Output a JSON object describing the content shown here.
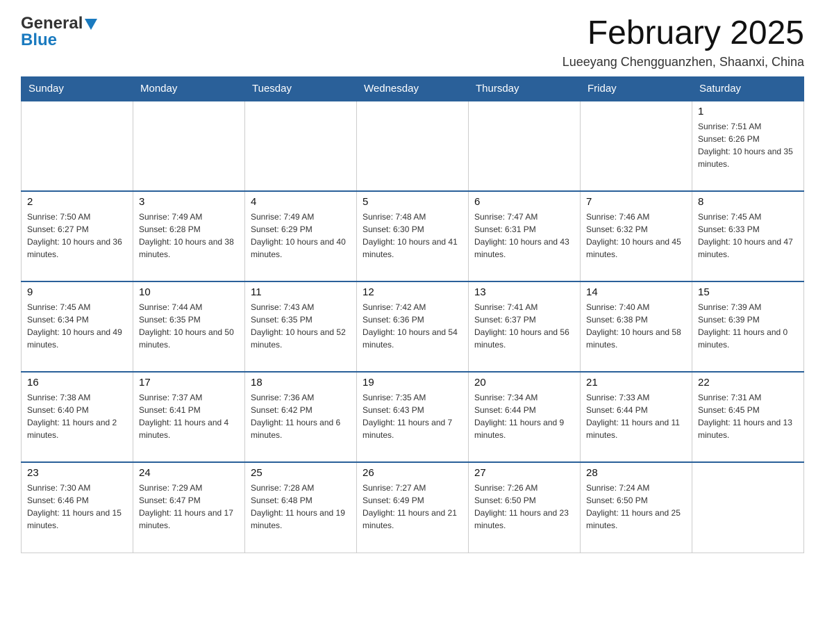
{
  "logo": {
    "general": "General",
    "blue": "Blue"
  },
  "title": "February 2025",
  "subtitle": "Lueeyang Chengguanzhen, Shaanxi, China",
  "days_of_week": [
    "Sunday",
    "Monday",
    "Tuesday",
    "Wednesday",
    "Thursday",
    "Friday",
    "Saturday"
  ],
  "weeks": [
    [
      {
        "day": "",
        "info": ""
      },
      {
        "day": "",
        "info": ""
      },
      {
        "day": "",
        "info": ""
      },
      {
        "day": "",
        "info": ""
      },
      {
        "day": "",
        "info": ""
      },
      {
        "day": "",
        "info": ""
      },
      {
        "day": "1",
        "info": "Sunrise: 7:51 AM\nSunset: 6:26 PM\nDaylight: 10 hours and 35 minutes."
      }
    ],
    [
      {
        "day": "2",
        "info": "Sunrise: 7:50 AM\nSunset: 6:27 PM\nDaylight: 10 hours and 36 minutes."
      },
      {
        "day": "3",
        "info": "Sunrise: 7:49 AM\nSunset: 6:28 PM\nDaylight: 10 hours and 38 minutes."
      },
      {
        "day": "4",
        "info": "Sunrise: 7:49 AM\nSunset: 6:29 PM\nDaylight: 10 hours and 40 minutes."
      },
      {
        "day": "5",
        "info": "Sunrise: 7:48 AM\nSunset: 6:30 PM\nDaylight: 10 hours and 41 minutes."
      },
      {
        "day": "6",
        "info": "Sunrise: 7:47 AM\nSunset: 6:31 PM\nDaylight: 10 hours and 43 minutes."
      },
      {
        "day": "7",
        "info": "Sunrise: 7:46 AM\nSunset: 6:32 PM\nDaylight: 10 hours and 45 minutes."
      },
      {
        "day": "8",
        "info": "Sunrise: 7:45 AM\nSunset: 6:33 PM\nDaylight: 10 hours and 47 minutes."
      }
    ],
    [
      {
        "day": "9",
        "info": "Sunrise: 7:45 AM\nSunset: 6:34 PM\nDaylight: 10 hours and 49 minutes."
      },
      {
        "day": "10",
        "info": "Sunrise: 7:44 AM\nSunset: 6:35 PM\nDaylight: 10 hours and 50 minutes."
      },
      {
        "day": "11",
        "info": "Sunrise: 7:43 AM\nSunset: 6:35 PM\nDaylight: 10 hours and 52 minutes."
      },
      {
        "day": "12",
        "info": "Sunrise: 7:42 AM\nSunset: 6:36 PM\nDaylight: 10 hours and 54 minutes."
      },
      {
        "day": "13",
        "info": "Sunrise: 7:41 AM\nSunset: 6:37 PM\nDaylight: 10 hours and 56 minutes."
      },
      {
        "day": "14",
        "info": "Sunrise: 7:40 AM\nSunset: 6:38 PM\nDaylight: 10 hours and 58 minutes."
      },
      {
        "day": "15",
        "info": "Sunrise: 7:39 AM\nSunset: 6:39 PM\nDaylight: 11 hours and 0 minutes."
      }
    ],
    [
      {
        "day": "16",
        "info": "Sunrise: 7:38 AM\nSunset: 6:40 PM\nDaylight: 11 hours and 2 minutes."
      },
      {
        "day": "17",
        "info": "Sunrise: 7:37 AM\nSunset: 6:41 PM\nDaylight: 11 hours and 4 minutes."
      },
      {
        "day": "18",
        "info": "Sunrise: 7:36 AM\nSunset: 6:42 PM\nDaylight: 11 hours and 6 minutes."
      },
      {
        "day": "19",
        "info": "Sunrise: 7:35 AM\nSunset: 6:43 PM\nDaylight: 11 hours and 7 minutes."
      },
      {
        "day": "20",
        "info": "Sunrise: 7:34 AM\nSunset: 6:44 PM\nDaylight: 11 hours and 9 minutes."
      },
      {
        "day": "21",
        "info": "Sunrise: 7:33 AM\nSunset: 6:44 PM\nDaylight: 11 hours and 11 minutes."
      },
      {
        "day": "22",
        "info": "Sunrise: 7:31 AM\nSunset: 6:45 PM\nDaylight: 11 hours and 13 minutes."
      }
    ],
    [
      {
        "day": "23",
        "info": "Sunrise: 7:30 AM\nSunset: 6:46 PM\nDaylight: 11 hours and 15 minutes."
      },
      {
        "day": "24",
        "info": "Sunrise: 7:29 AM\nSunset: 6:47 PM\nDaylight: 11 hours and 17 minutes."
      },
      {
        "day": "25",
        "info": "Sunrise: 7:28 AM\nSunset: 6:48 PM\nDaylight: 11 hours and 19 minutes."
      },
      {
        "day": "26",
        "info": "Sunrise: 7:27 AM\nSunset: 6:49 PM\nDaylight: 11 hours and 21 minutes."
      },
      {
        "day": "27",
        "info": "Sunrise: 7:26 AM\nSunset: 6:50 PM\nDaylight: 11 hours and 23 minutes."
      },
      {
        "day": "28",
        "info": "Sunrise: 7:24 AM\nSunset: 6:50 PM\nDaylight: 11 hours and 25 minutes."
      },
      {
        "day": "",
        "info": ""
      }
    ]
  ]
}
